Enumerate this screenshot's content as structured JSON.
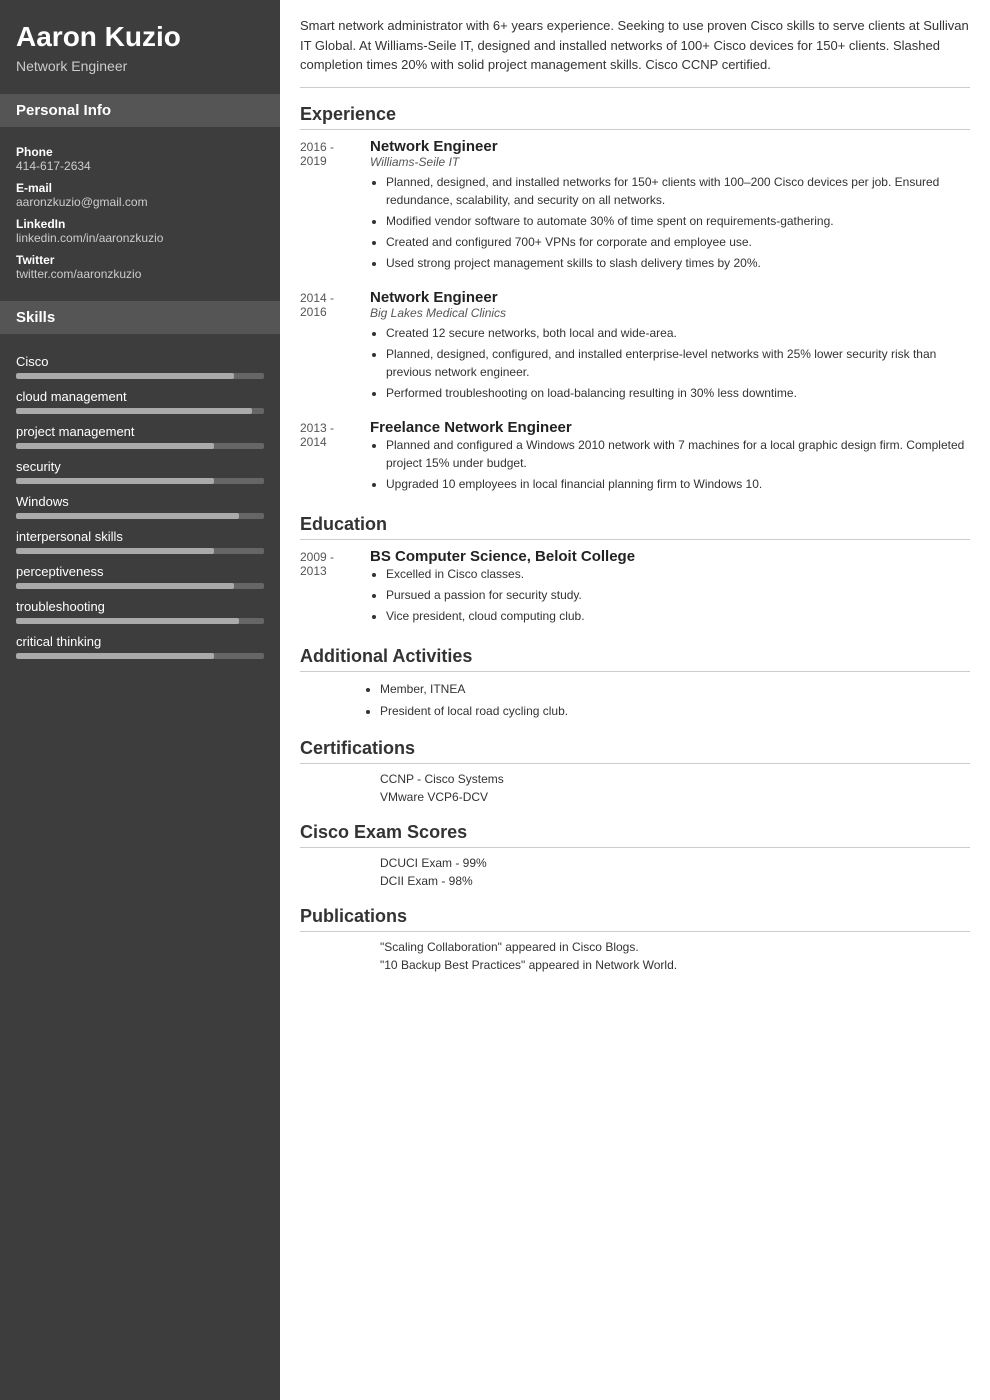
{
  "sidebar": {
    "name": "Aaron Kuzio",
    "title": "Network Engineer",
    "personal_info_label": "Personal Info",
    "phone_label": "Phone",
    "phone_value": "414-617-2634",
    "email_label": "E-mail",
    "email_value": "aaronzkuzio@gmail.com",
    "linkedin_label": "LinkedIn",
    "linkedin_value": "linkedin.com/in/aaronzkuzio",
    "twitter_label": "Twitter",
    "twitter_value": "twitter.com/aaronzkuzio",
    "skills_label": "Skills",
    "skills": [
      {
        "name": "Cisco",
        "percent": 88
      },
      {
        "name": "cloud management",
        "percent": 95
      },
      {
        "name": "project management",
        "percent": 80
      },
      {
        "name": "security",
        "percent": 80
      },
      {
        "name": "Windows",
        "percent": 90
      },
      {
        "name": "interpersonal skills",
        "percent": 80
      },
      {
        "name": "perceptiveness",
        "percent": 88
      },
      {
        "name": "troubleshooting",
        "percent": 90
      },
      {
        "name": "critical thinking",
        "percent": 80
      }
    ]
  },
  "summary": "Smart network administrator with 6+ years experience. Seeking to use proven Cisco skills to serve clients at Sullivan IT Global. At Williams-Seile IT, designed and installed networks of 100+ Cisco devices for 150+ clients. Slashed completion times 20% with solid project management skills. Cisco CCNP certified.",
  "experience_label": "Experience",
  "experience": [
    {
      "dates": "2016 -\n2019",
      "title": "Network Engineer",
      "company": "Williams-Seile IT",
      "bullets": [
        "Planned, designed, and installed networks for 150+ clients with 100–200 Cisco devices per job. Ensured redundance, scalability, and security on all networks.",
        "Modified vendor software to automate 30% of time spent on requirements-gathering.",
        "Created and configured 700+ VPNs for corporate and employee use.",
        "Used strong project management skills to slash delivery times by 20%."
      ]
    },
    {
      "dates": "2014 -\n2016",
      "title": "Network Engineer",
      "company": "Big Lakes Medical Clinics",
      "bullets": [
        "Created 12 secure networks, both local and wide-area.",
        "Planned, designed, configured, and installed enterprise-level networks with 25% lower security risk than previous network engineer.",
        "Performed troubleshooting on load-balancing resulting in 30% less downtime."
      ]
    },
    {
      "dates": "2013 -\n2014",
      "title": "Freelance Network Engineer",
      "company": "",
      "bullets": [
        "Planned and configured a Windows 2010 network with 7 machines for a local graphic design firm. Completed project 15% under budget.",
        "Upgraded 10 employees in local financial planning firm to Windows 10."
      ]
    }
  ],
  "education_label": "Education",
  "education": [
    {
      "dates": "2009 -\n2013",
      "degree": "BS Computer Science, Beloit College",
      "bullets": [
        "Excelled in Cisco classes.",
        "Pursued a passion for security study.",
        "Vice president, cloud computing club."
      ]
    }
  ],
  "additional_activities_label": "Additional Activities",
  "additional_activities": [
    "Member, ITNEA",
    "President of local road cycling club."
  ],
  "certifications_label": "Certifications",
  "certifications": [
    "CCNP - Cisco Systems",
    "VMware VCP6-DCV"
  ],
  "exam_scores_label": "Cisco Exam Scores",
  "exam_scores": [
    "DCUCI Exam - 99%",
    "DCII Exam - 98%"
  ],
  "publications_label": "Publications",
  "publications": [
    "\"Scaling Collaboration\" appeared in Cisco Blogs.",
    "\"10 Backup Best Practices\" appeared in Network World."
  ]
}
